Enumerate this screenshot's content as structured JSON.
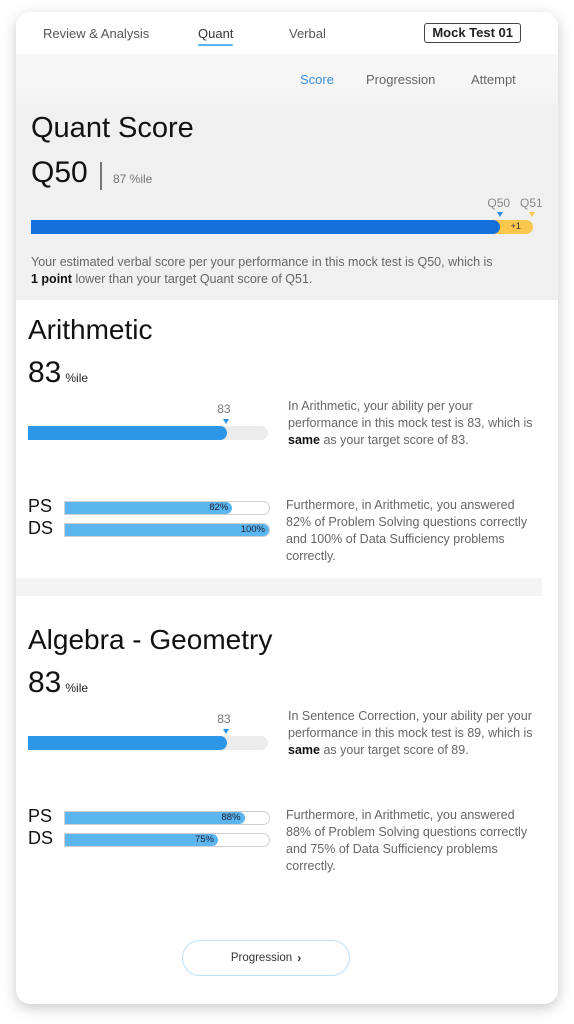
{
  "topnav": {
    "tabs": [
      {
        "label": "Review & Analysis",
        "active": false
      },
      {
        "label": "Quant",
        "active": true
      },
      {
        "label": "Verbal",
        "active": false
      }
    ],
    "badge": "Mock Test 01"
  },
  "subnav": {
    "tabs": [
      {
        "label": "Score",
        "active": true
      },
      {
        "label": "Progression",
        "active": false
      },
      {
        "label": "Attempt",
        "active": false
      }
    ]
  },
  "score": {
    "title": "Quant Score",
    "value": "Q50",
    "percentile": "87 %ile",
    "current_label": "Q50",
    "target_label": "Q51",
    "current_fraction": 0.935,
    "target_fraction": 1.0,
    "gap_label": "+1",
    "desc_1": "Your estimated verbal score per your performance in this mock test is Q50, which is",
    "desc_bold": "1 point",
    "desc_2": " lower than your target Quant score of Q51."
  },
  "topics": [
    {
      "title": "Arithmetic",
      "percentile": "83",
      "percentile_unit": "%ile",
      "ability_label": "83",
      "ability_percent": 83,
      "desc_1": "In Arithmetic, your ability per your performance in this mock test is 83, which is ",
      "desc_bold": "same",
      "desc_2": " as your target score of 83.",
      "ps_label": "PS",
      "ps_value": "82%",
      "ps_percent": 82,
      "ds_label": "DS",
      "ds_value": "100%",
      "ds_percent": 100,
      "desc2": "Furthermore, in Arithmetic, you answered 82% of Problem Solving questions correctly and 100% of Data Sufficiency problems correctly."
    },
    {
      "title": "Algebra - Geometry",
      "percentile": "83",
      "percentile_unit": "%ile",
      "ability_label": "83",
      "ability_percent": 83,
      "desc_1": "In Sentence Correction, your ability per your performance in this mock test is 89, which is ",
      "desc_bold": "same",
      "desc_2": " as your target score of 89.",
      "ps_label": "PS",
      "ps_value": "88%",
      "ps_percent": 88,
      "ds_label": "DS",
      "ds_value": "75%",
      "ds_percent": 75,
      "desc2": "Furthermore, in Arithmetic, you answered 88% of Problem Solving questions correctly and 75% of Data Sufficiency problems correctly."
    }
  ],
  "footer": {
    "button_label": "Progression",
    "button_icon": "chevron-right-icon"
  },
  "colors": {
    "accent": "#3a8fe0",
    "score_bar": "#1670db",
    "target_gap": "#fcc74f",
    "ability_bar": "#2c96e8",
    "sub_bar": "#5bb5ef"
  }
}
